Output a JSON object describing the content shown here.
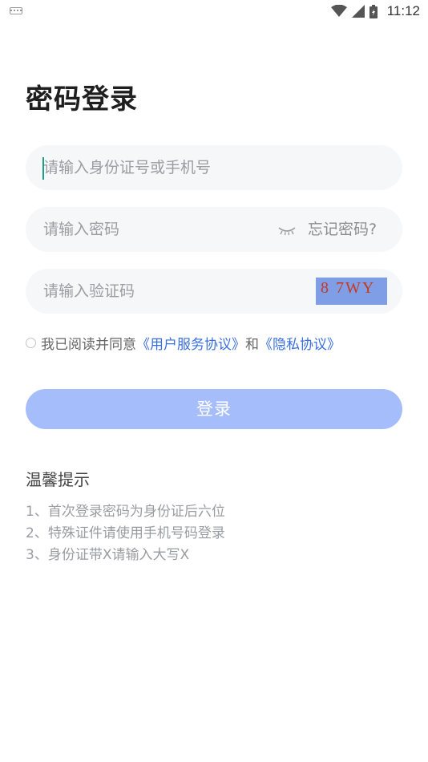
{
  "status_bar": {
    "time": "11:12",
    "icons": [
      "keyboard-icon",
      "wifi-icon",
      "signal-icon",
      "battery-icon"
    ]
  },
  "page": {
    "title": "密码登录"
  },
  "form": {
    "id_placeholder": "请输入身份证号或手机号",
    "password_placeholder": "请输入密码",
    "forgot_label": "忘记密码?",
    "captcha_placeholder": "请输入验证码",
    "captcha_code": "8 7WY"
  },
  "agreement": {
    "prefix": "我已阅读并同意",
    "terms_link": "《用户服务协议》",
    "conjunction": "和",
    "privacy_link": "《隐私协议》",
    "checked": false
  },
  "login_button": {
    "label": "登录"
  },
  "tips": {
    "title": "温馨提示",
    "items": [
      "1、首次登录密码为身份证后六位",
      "2、特殊证件请使用手机号码登录",
      "3、身份证带X请输入大写X"
    ]
  },
  "colors": {
    "accent": "#3a6fe0",
    "button_disabled": "#a6bdfb",
    "input_bg": "#f6f7f9",
    "caret": "#1a9e86"
  }
}
